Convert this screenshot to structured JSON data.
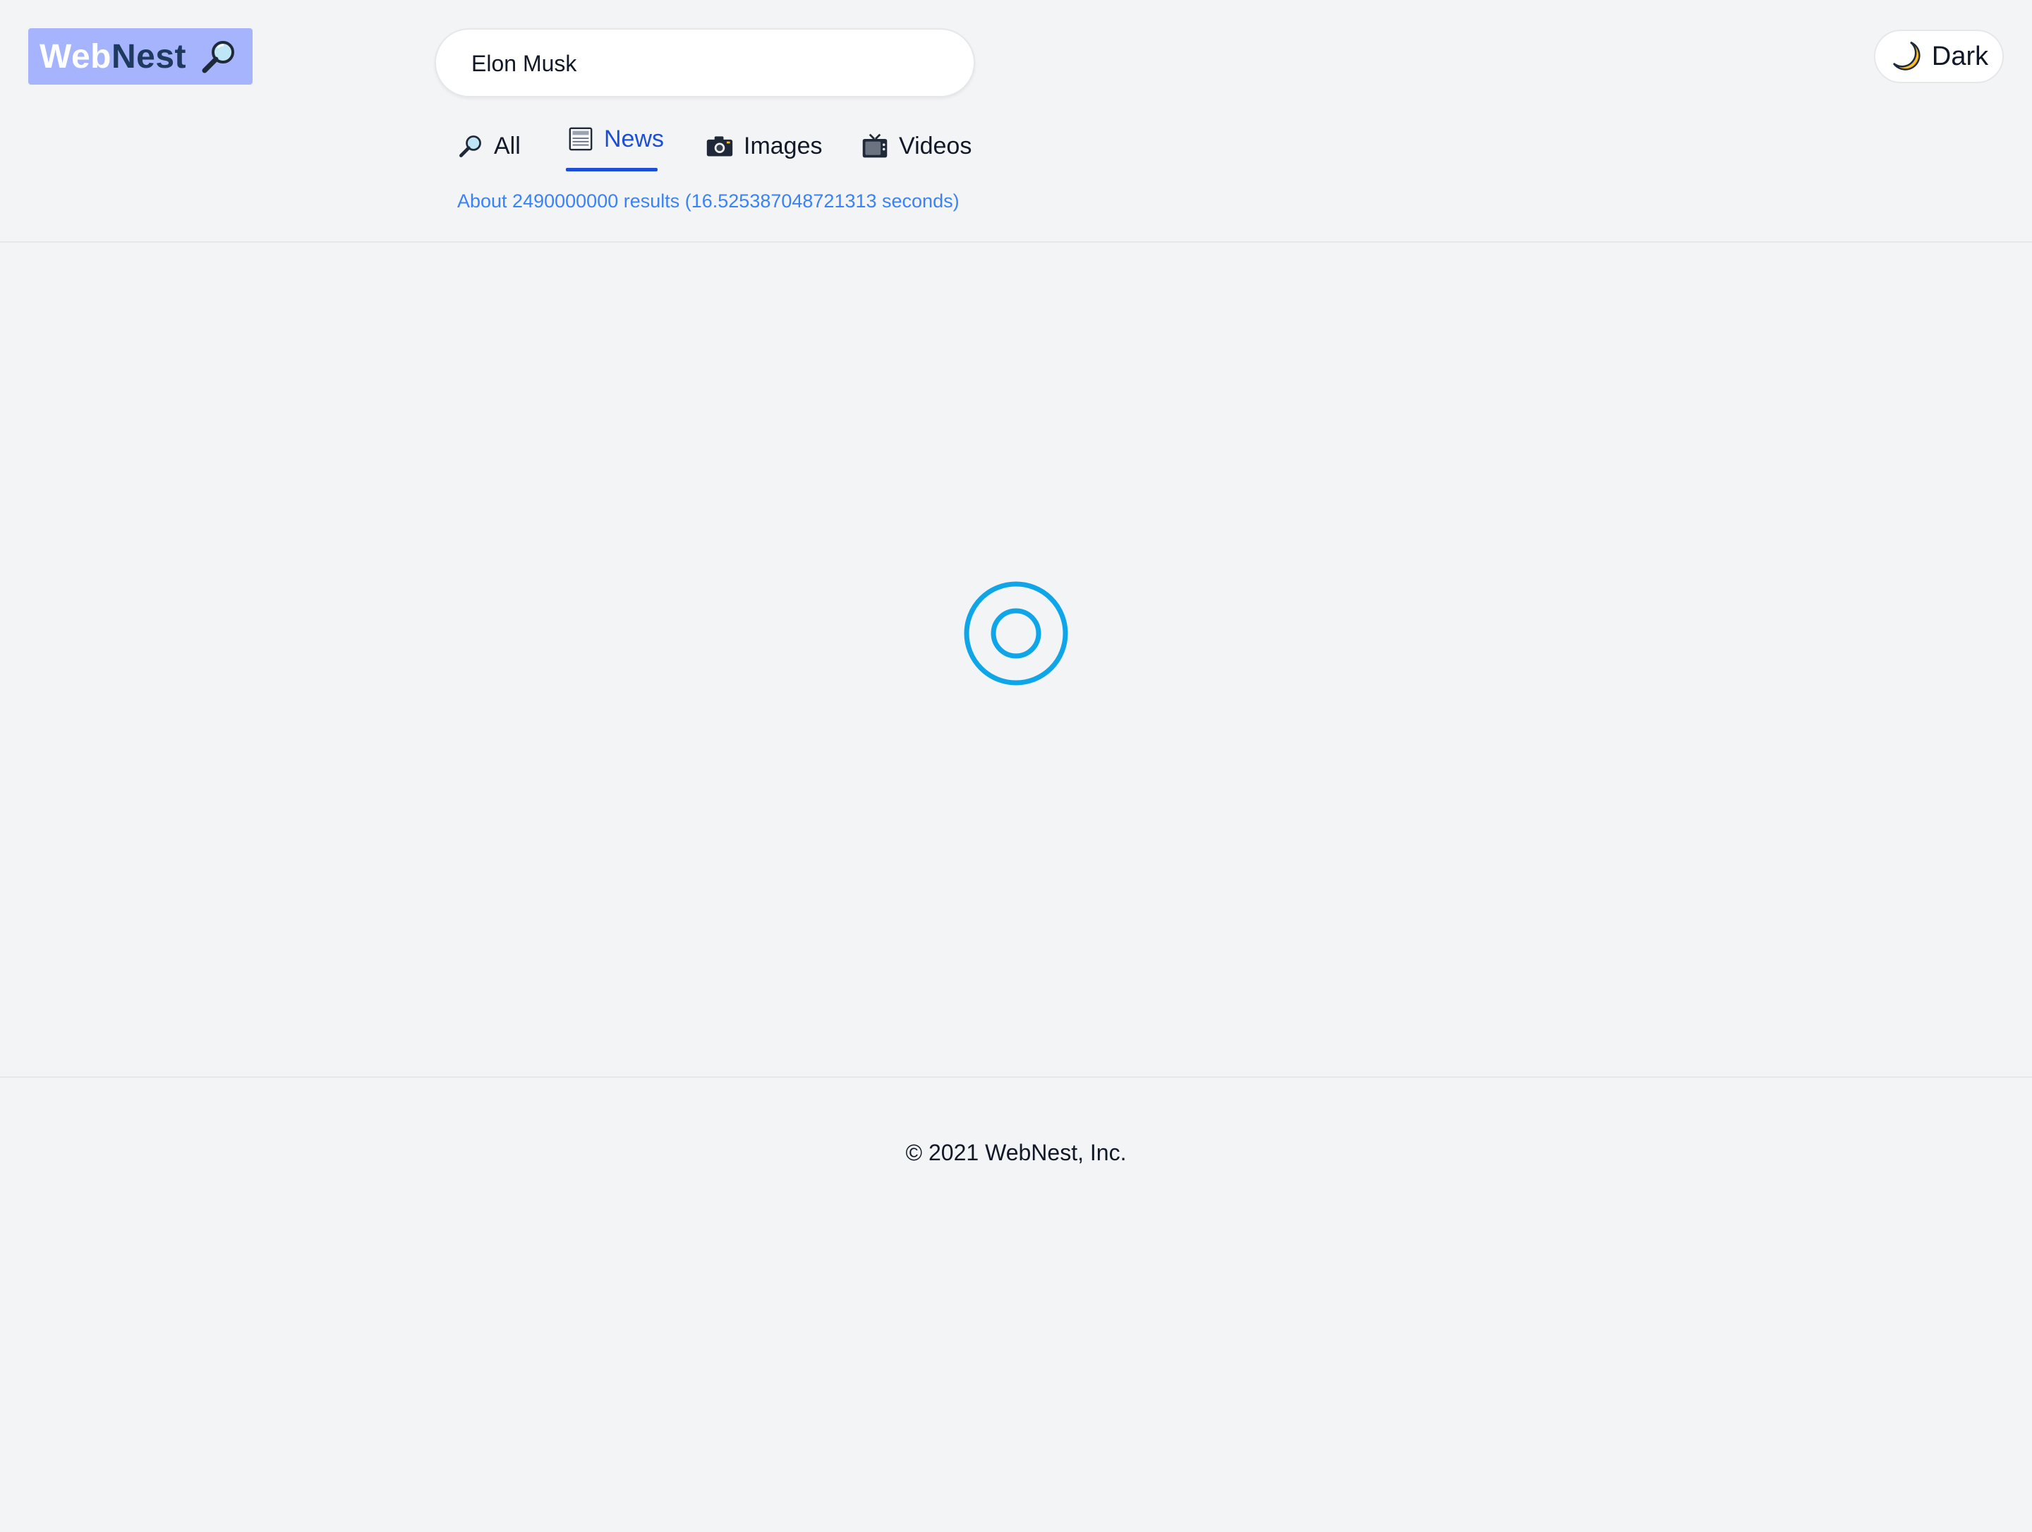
{
  "header": {
    "logo": {
      "part1": "Web",
      "part2": "Nest",
      "icon": "magnifier-icon"
    },
    "search": {
      "value": "Elon Musk",
      "placeholder": ""
    },
    "tabs": [
      {
        "label": "All",
        "icon": "magnifier-icon",
        "active": false
      },
      {
        "label": "News",
        "icon": "newspaper-icon",
        "active": true
      },
      {
        "label": "Images",
        "icon": "camera-icon",
        "active": false
      },
      {
        "label": "Videos",
        "icon": "tv-icon",
        "active": false
      }
    ],
    "results_info": "About 2490000000 results (16.525387048721313 seconds)",
    "theme_toggle": {
      "label": "Dark",
      "icon": "moon-icon"
    }
  },
  "main": {
    "state": "loading",
    "spinner_icon": "loading-spinner-icon"
  },
  "footer": {
    "copyright": "© 2021 WebNest, Inc."
  },
  "colors": {
    "background": "#f3f4f6",
    "accent": "#1d4ed8",
    "results_text": "#3b82f6",
    "logo_bg": "#a5b4fc",
    "spinner": "#0ea5e9"
  }
}
